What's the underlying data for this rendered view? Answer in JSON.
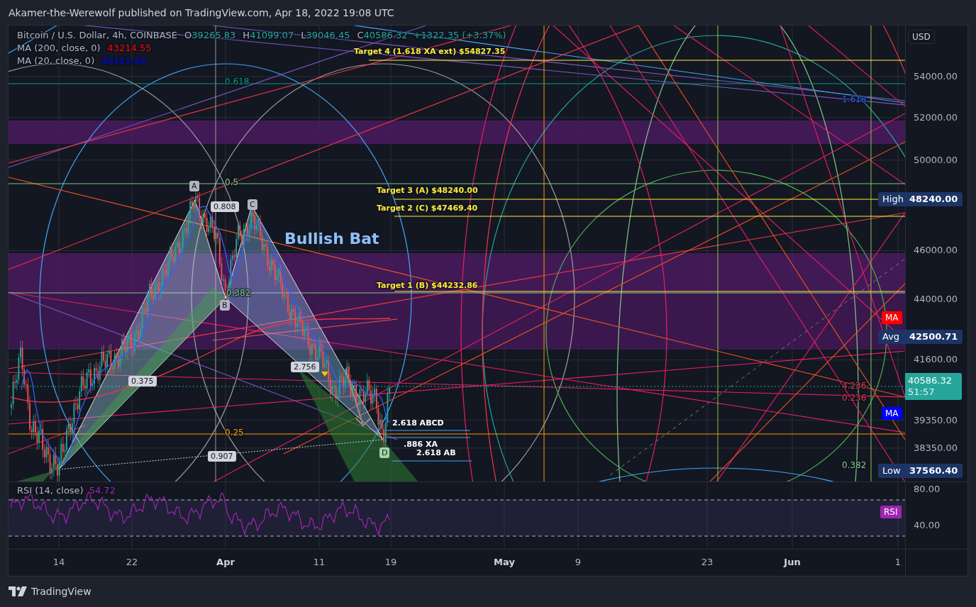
{
  "header": {
    "text": "Akamer-the-Werewolf published on TradingView.com, Apr 18, 2022 19:08 UTC"
  },
  "legend": {
    "symbol": "Bitcoin / U.S. Dollar, 4h, COINBASE",
    "ohlc": [
      {
        "key": "O",
        "value": "39265.83"
      },
      {
        "key": "H",
        "value": "41099.07"
      },
      {
        "key": "L",
        "value": "39046.45"
      },
      {
        "key": "C",
        "value": "40586.32"
      }
    ],
    "change": "+1322.35 (+3.37%)",
    "indicators": [
      {
        "label": "MA (200, close, 0)",
        "value": "43214.55",
        "color": "#ff0000",
        "badge": "MA"
      },
      {
        "label": "MA (20, close, 0)",
        "value": "40121.40",
        "color": "#0000ff",
        "badge": "MA"
      }
    ]
  },
  "chart": {
    "title": "Bullish Bat",
    "targets": [
      "Target 4 (1.618 XA ext) $54827.35",
      "Target 3 (A) $48240.00",
      "Target 2 (C) $47469.40",
      "Target 1 (B) $44232.86"
    ],
    "points": [
      {
        "label": "A",
        "color": "#b2b5be"
      },
      {
        "label": "B",
        "color": "#b2b5be"
      },
      {
        "label": "C",
        "color": "#b2b5be"
      },
      {
        "label": "D",
        "color": "#a5d6a7"
      }
    ],
    "ratios": [
      "0.808",
      "0.375",
      "2.756",
      "0.907"
    ],
    "measures": [
      "2.618 ABCD",
      ".886 XA",
      "2.618 AB"
    ],
    "fib_labels": [
      {
        "text": "0.618",
        "color": "#089981"
      },
      {
        "text": "0.5",
        "color": "#81c784"
      },
      {
        "text": "0.382",
        "color": "#81c784"
      },
      {
        "text": "0.25",
        "color": "#ff9800"
      },
      {
        "text": "1.618",
        "color": "#2962ff"
      },
      {
        "text": "4.236",
        "color": "#f23645"
      },
      {
        "text": "0.236",
        "color": "#f23645"
      },
      {
        "text": "0.382",
        "color": "#81c784"
      }
    ]
  },
  "price_axis": {
    "currency": "USD",
    "ticks": [
      "54000.00",
      "52000.00",
      "50000.00",
      "46000.00",
      "44000.00",
      "41600.00",
      "39350.00",
      "38350.00"
    ],
    "badges": [
      {
        "kind": "level",
        "label": "High",
        "value": "48240.00"
      },
      {
        "kind": "level",
        "label": "Avg",
        "value": "42500.71"
      },
      {
        "kind": "price",
        "value": "40586.32",
        "countdown": "51:57"
      },
      {
        "kind": "level",
        "label": "Low",
        "value": "37560.40"
      }
    ]
  },
  "rsi": {
    "label": "RSI (14, close)",
    "value": "54.72",
    "ticks": [
      "80.00",
      "40.00"
    ],
    "badge": "RSI"
  },
  "time_axis": {
    "ticks": [
      {
        "label": "14",
        "bold": false
      },
      {
        "label": "22",
        "bold": false
      },
      {
        "label": "Apr",
        "bold": true
      },
      {
        "label": "11",
        "bold": false
      },
      {
        "label": "19",
        "bold": false
      },
      {
        "label": "May",
        "bold": true
      },
      {
        "label": "9",
        "bold": false
      },
      {
        "label": "23",
        "bold": false
      },
      {
        "label": "Jun",
        "bold": true
      },
      {
        "label": "1",
        "bold": false
      }
    ]
  },
  "footer": {
    "brand": "TradingView"
  }
}
